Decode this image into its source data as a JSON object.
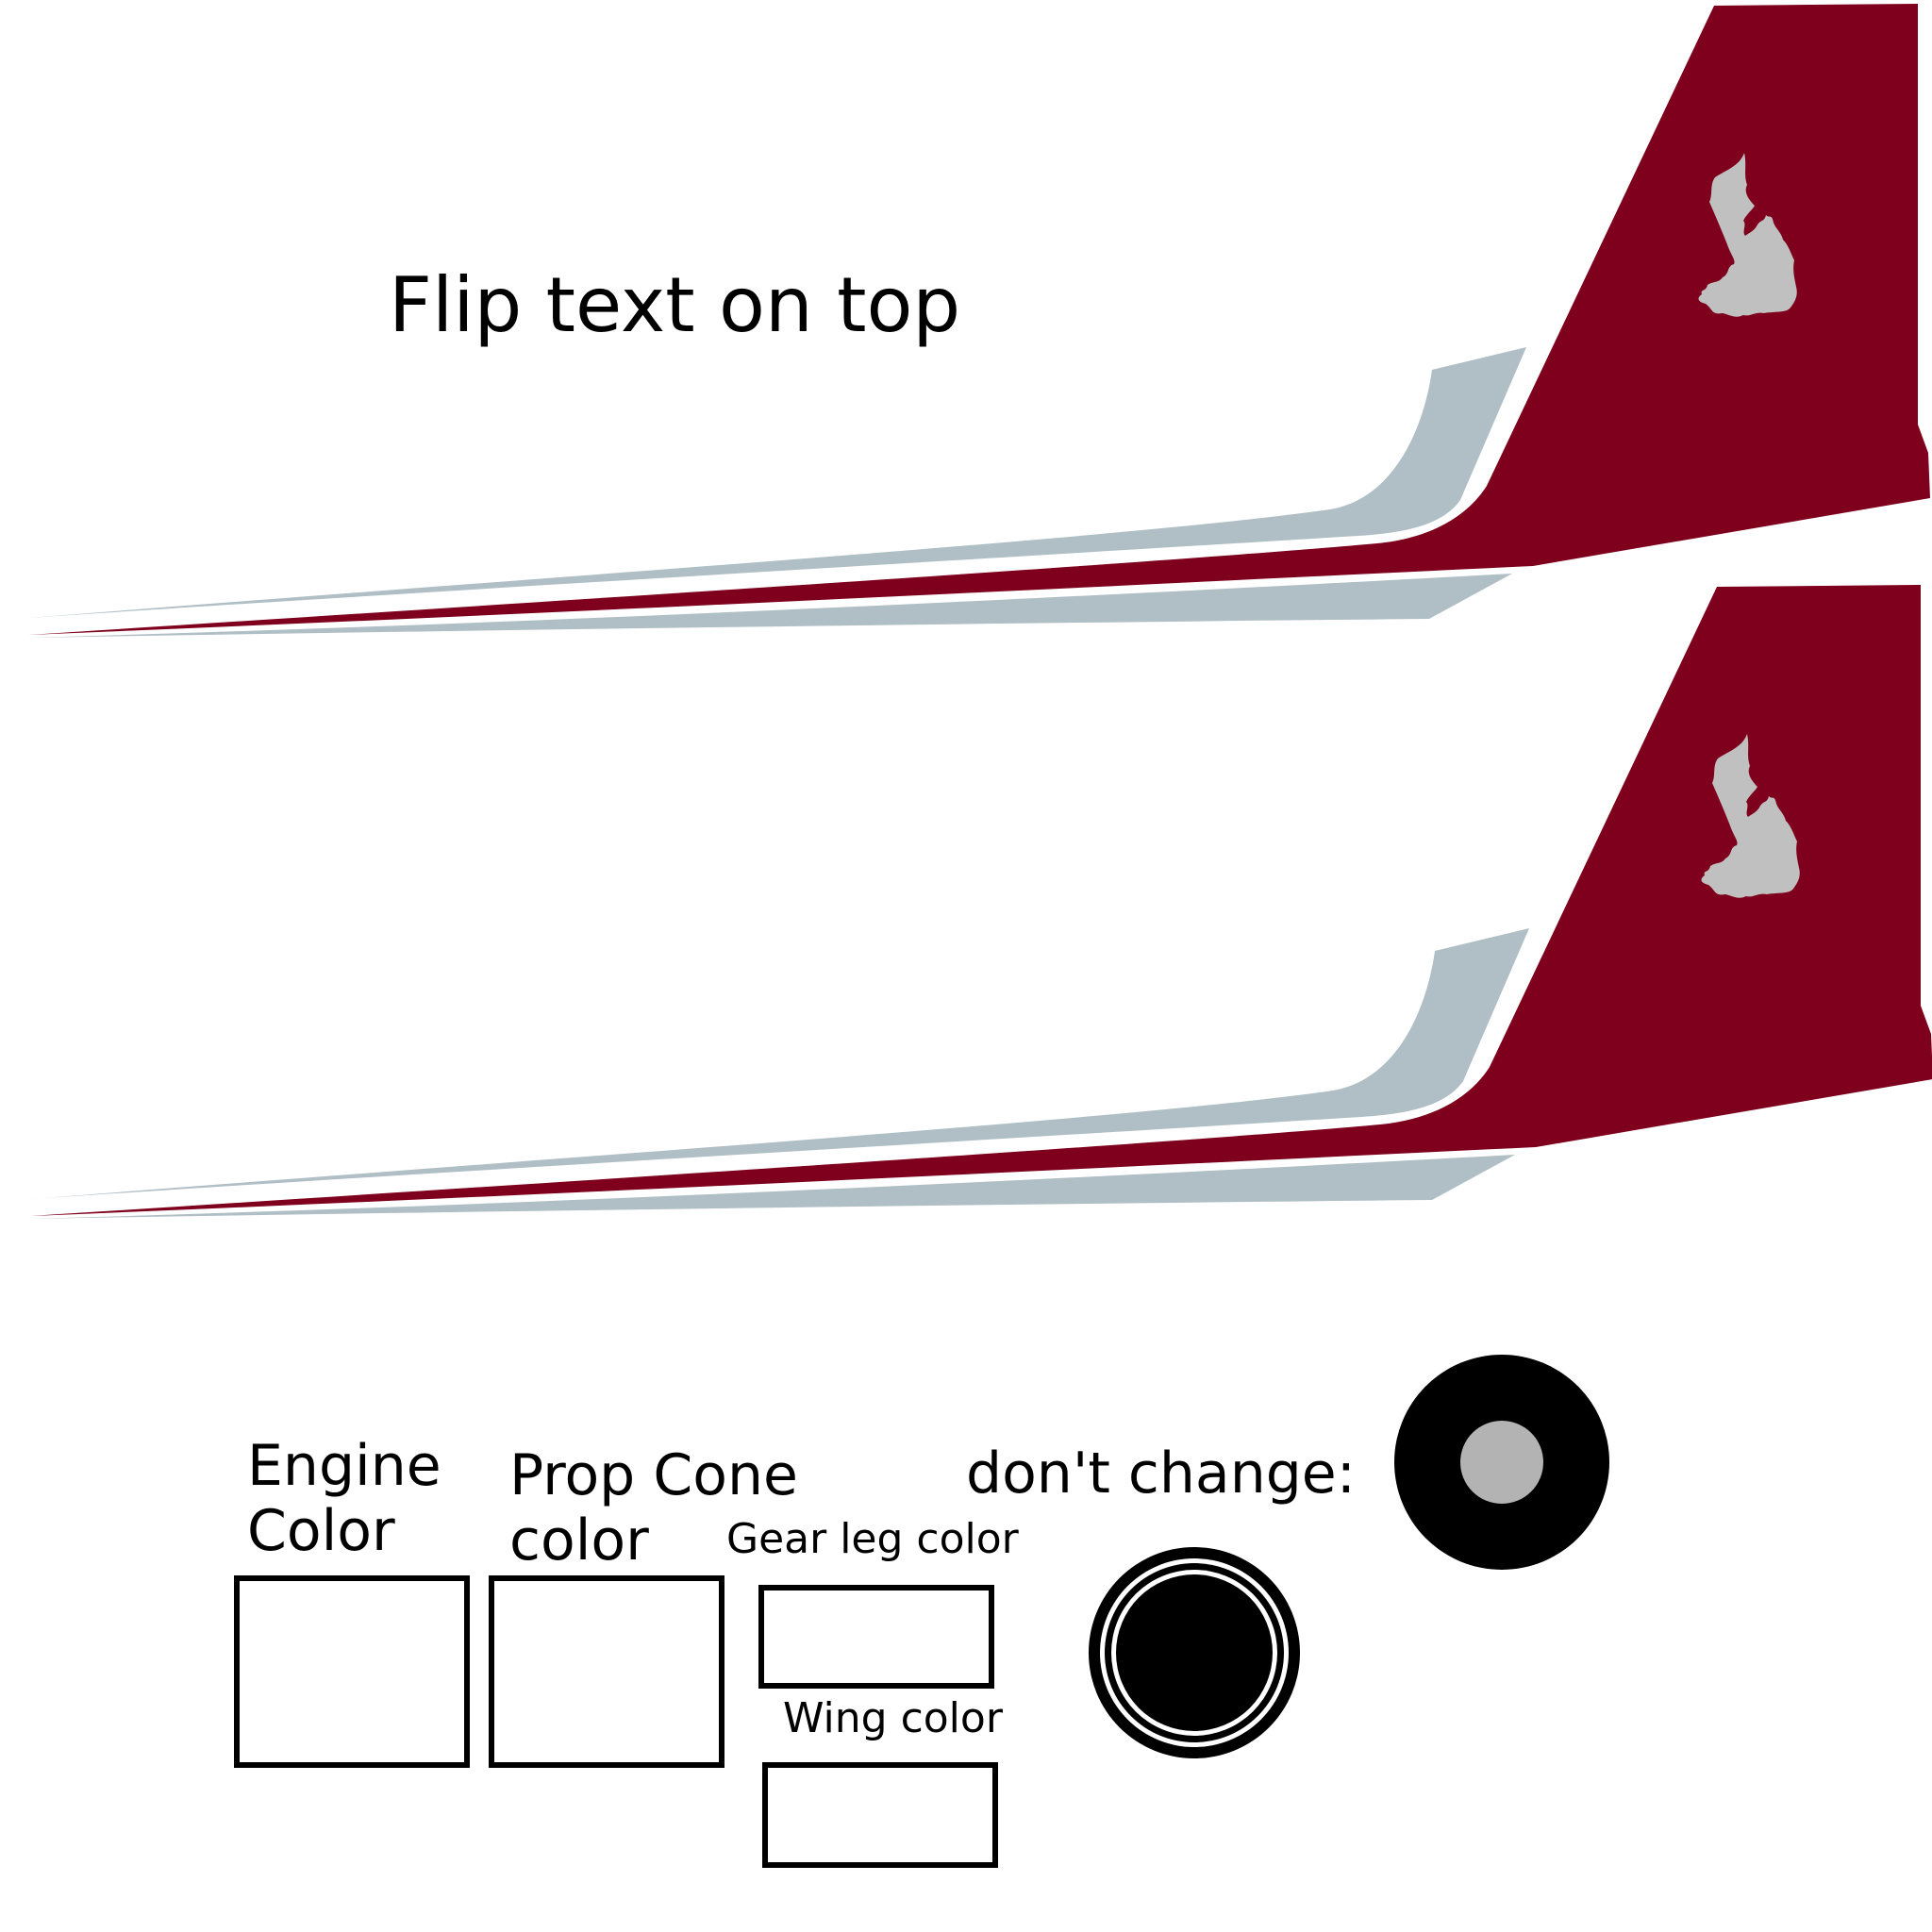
{
  "texts": {
    "title": "Flip text on top",
    "engine_color": "Engine\nColor",
    "prop_cone_color": "Prop Cone\ncolor",
    "gear_leg_color": "Gear leg color",
    "wing_color": "Wing color",
    "dont_change": "don't change:"
  },
  "colors": {
    "tail_red": "#7f001c",
    "stripe_gray": "#b0bec5",
    "logo_gray": "#c0c0c0",
    "hub_gray": "#b3b3b3",
    "outline_black": "#000000",
    "background": "#ffffff"
  },
  "icons": {
    "tail_logo": "island-silhouette-icon",
    "spinner": "propeller-spinner-icon",
    "wheel": "wheel-icon"
  }
}
